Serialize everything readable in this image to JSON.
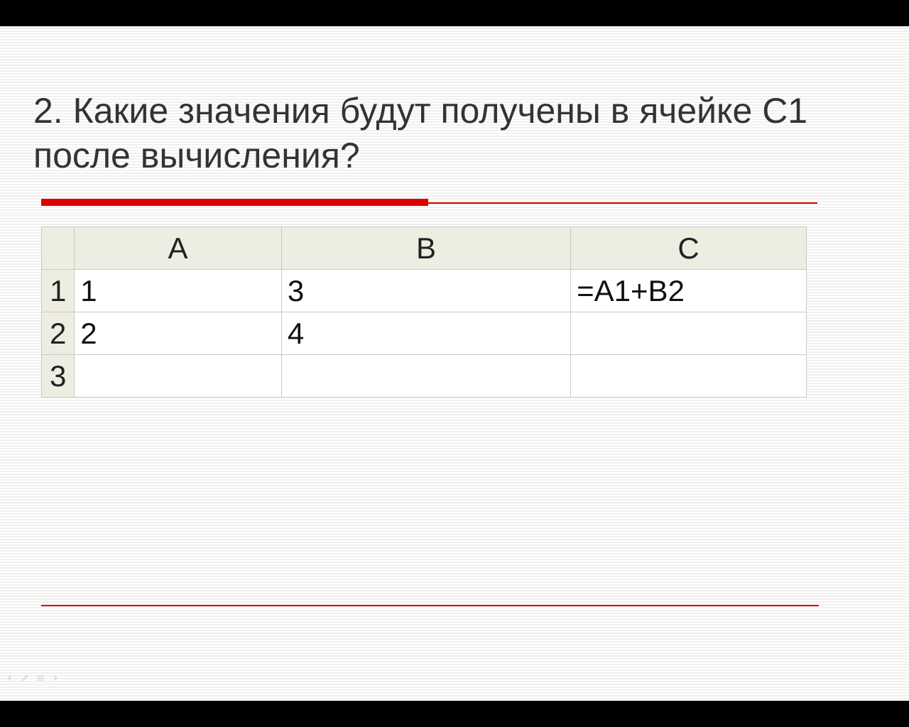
{
  "title": "2. Какие значения будут получены в ячейке С1 после вычисления?",
  "spreadsheet": {
    "columns": [
      "A",
      "B",
      "C"
    ],
    "rows": [
      {
        "num": "1",
        "cells": [
          "1",
          "3",
          "=A1+B2"
        ]
      },
      {
        "num": "2",
        "cells": [
          "2",
          "4",
          ""
        ]
      },
      {
        "num": "3",
        "cells": [
          "",
          "",
          ""
        ]
      }
    ]
  }
}
